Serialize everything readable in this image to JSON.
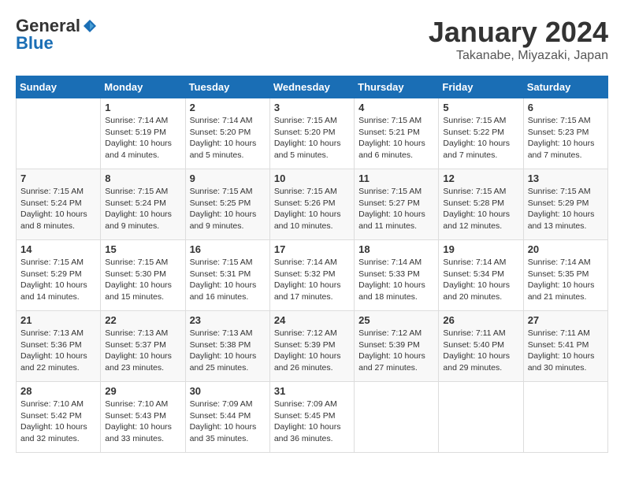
{
  "header": {
    "logo": {
      "general": "General",
      "blue": "Blue"
    },
    "title": "January 2024",
    "location": "Takanabe, Miyazaki, Japan"
  },
  "weekdays": [
    "Sunday",
    "Monday",
    "Tuesday",
    "Wednesday",
    "Thursday",
    "Friday",
    "Saturday"
  ],
  "weeks": [
    [
      {
        "day": null,
        "info": null
      },
      {
        "day": "1",
        "info": "Sunrise: 7:14 AM\nSunset: 5:19 PM\nDaylight: 10 hours\nand 4 minutes."
      },
      {
        "day": "2",
        "info": "Sunrise: 7:14 AM\nSunset: 5:20 PM\nDaylight: 10 hours\nand 5 minutes."
      },
      {
        "day": "3",
        "info": "Sunrise: 7:15 AM\nSunset: 5:20 PM\nDaylight: 10 hours\nand 5 minutes."
      },
      {
        "day": "4",
        "info": "Sunrise: 7:15 AM\nSunset: 5:21 PM\nDaylight: 10 hours\nand 6 minutes."
      },
      {
        "day": "5",
        "info": "Sunrise: 7:15 AM\nSunset: 5:22 PM\nDaylight: 10 hours\nand 7 minutes."
      },
      {
        "day": "6",
        "info": "Sunrise: 7:15 AM\nSunset: 5:23 PM\nDaylight: 10 hours\nand 7 minutes."
      }
    ],
    [
      {
        "day": "7",
        "info": "Sunrise: 7:15 AM\nSunset: 5:24 PM\nDaylight: 10 hours\nand 8 minutes."
      },
      {
        "day": "8",
        "info": "Sunrise: 7:15 AM\nSunset: 5:24 PM\nDaylight: 10 hours\nand 9 minutes."
      },
      {
        "day": "9",
        "info": "Sunrise: 7:15 AM\nSunset: 5:25 PM\nDaylight: 10 hours\nand 9 minutes."
      },
      {
        "day": "10",
        "info": "Sunrise: 7:15 AM\nSunset: 5:26 PM\nDaylight: 10 hours\nand 10 minutes."
      },
      {
        "day": "11",
        "info": "Sunrise: 7:15 AM\nSunset: 5:27 PM\nDaylight: 10 hours\nand 11 minutes."
      },
      {
        "day": "12",
        "info": "Sunrise: 7:15 AM\nSunset: 5:28 PM\nDaylight: 10 hours\nand 12 minutes."
      },
      {
        "day": "13",
        "info": "Sunrise: 7:15 AM\nSunset: 5:29 PM\nDaylight: 10 hours\nand 13 minutes."
      }
    ],
    [
      {
        "day": "14",
        "info": "Sunrise: 7:15 AM\nSunset: 5:29 PM\nDaylight: 10 hours\nand 14 minutes."
      },
      {
        "day": "15",
        "info": "Sunrise: 7:15 AM\nSunset: 5:30 PM\nDaylight: 10 hours\nand 15 minutes."
      },
      {
        "day": "16",
        "info": "Sunrise: 7:15 AM\nSunset: 5:31 PM\nDaylight: 10 hours\nand 16 minutes."
      },
      {
        "day": "17",
        "info": "Sunrise: 7:14 AM\nSunset: 5:32 PM\nDaylight: 10 hours\nand 17 minutes."
      },
      {
        "day": "18",
        "info": "Sunrise: 7:14 AM\nSunset: 5:33 PM\nDaylight: 10 hours\nand 18 minutes."
      },
      {
        "day": "19",
        "info": "Sunrise: 7:14 AM\nSunset: 5:34 PM\nDaylight: 10 hours\nand 20 minutes."
      },
      {
        "day": "20",
        "info": "Sunrise: 7:14 AM\nSunset: 5:35 PM\nDaylight: 10 hours\nand 21 minutes."
      }
    ],
    [
      {
        "day": "21",
        "info": "Sunrise: 7:13 AM\nSunset: 5:36 PM\nDaylight: 10 hours\nand 22 minutes."
      },
      {
        "day": "22",
        "info": "Sunrise: 7:13 AM\nSunset: 5:37 PM\nDaylight: 10 hours\nand 23 minutes."
      },
      {
        "day": "23",
        "info": "Sunrise: 7:13 AM\nSunset: 5:38 PM\nDaylight: 10 hours\nand 25 minutes."
      },
      {
        "day": "24",
        "info": "Sunrise: 7:12 AM\nSunset: 5:39 PM\nDaylight: 10 hours\nand 26 minutes."
      },
      {
        "day": "25",
        "info": "Sunrise: 7:12 AM\nSunset: 5:39 PM\nDaylight: 10 hours\nand 27 minutes."
      },
      {
        "day": "26",
        "info": "Sunrise: 7:11 AM\nSunset: 5:40 PM\nDaylight: 10 hours\nand 29 minutes."
      },
      {
        "day": "27",
        "info": "Sunrise: 7:11 AM\nSunset: 5:41 PM\nDaylight: 10 hours\nand 30 minutes."
      }
    ],
    [
      {
        "day": "28",
        "info": "Sunrise: 7:10 AM\nSunset: 5:42 PM\nDaylight: 10 hours\nand 32 minutes."
      },
      {
        "day": "29",
        "info": "Sunrise: 7:10 AM\nSunset: 5:43 PM\nDaylight: 10 hours\nand 33 minutes."
      },
      {
        "day": "30",
        "info": "Sunrise: 7:09 AM\nSunset: 5:44 PM\nDaylight: 10 hours\nand 35 minutes."
      },
      {
        "day": "31",
        "info": "Sunrise: 7:09 AM\nSunset: 5:45 PM\nDaylight: 10 hours\nand 36 minutes."
      },
      {
        "day": null,
        "info": null
      },
      {
        "day": null,
        "info": null
      },
      {
        "day": null,
        "info": null
      }
    ]
  ]
}
